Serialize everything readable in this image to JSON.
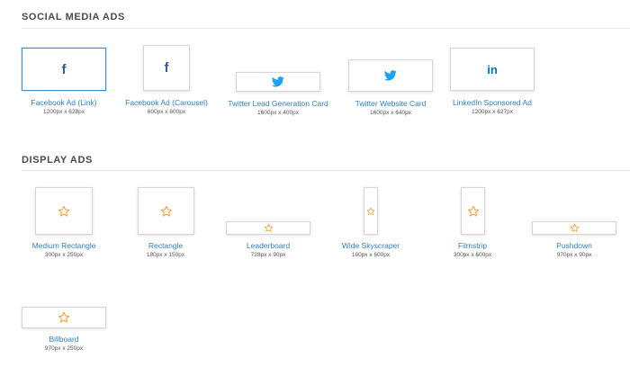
{
  "sections": {
    "social": {
      "title": "SOCIAL MEDIA ADS",
      "items": [
        {
          "label": "Facebook Ad (Link)",
          "dims": "1200px x 628px",
          "icon": "facebook-icon",
          "glyph": "f"
        },
        {
          "label": "Facebook Ad (Carousel)",
          "dims": "600px x 600px",
          "icon": "facebook-icon",
          "glyph": "f"
        },
        {
          "label": "Twitter Lead Generation Card",
          "dims": "1600px x 400px",
          "icon": "twitter-bird-icon"
        },
        {
          "label": "Twitter Website Card",
          "dims": "1600px x 640px",
          "icon": "twitter-bird-icon"
        },
        {
          "label": "LinkedIn Sponsored Ad",
          "dims": "1200px x 627px",
          "icon": "linkedin-icon",
          "glyph": "in"
        }
      ]
    },
    "display": {
      "title": "DISPLAY ADS",
      "items": [
        {
          "label": "Medium Rectangle",
          "dims": "300px x 250px",
          "icon": "star-icon"
        },
        {
          "label": "Rectangle",
          "dims": "180px x 150px",
          "icon": "star-icon"
        },
        {
          "label": "Leaderboard",
          "dims": "728px x 90px",
          "icon": "star-icon"
        },
        {
          "label": "Wide Skyscraper",
          "dims": "160px x 600px",
          "icon": "star-icon"
        },
        {
          "label": "Filmstrip",
          "dims": "300px x 600px",
          "icon": "star-icon"
        },
        {
          "label": "Pushdown",
          "dims": "970px x 90px",
          "icon": "star-icon"
        },
        {
          "label": "Billboard",
          "dims": "970px x 250px",
          "icon": "star-icon"
        }
      ]
    }
  },
  "colors": {
    "link": "#2f7fc1",
    "facebook": "#3b5998",
    "twitter": "#1da1f2",
    "linkedin": "#0077b5",
    "star": "#f0a030",
    "selected_border": "#3b8fd6"
  }
}
